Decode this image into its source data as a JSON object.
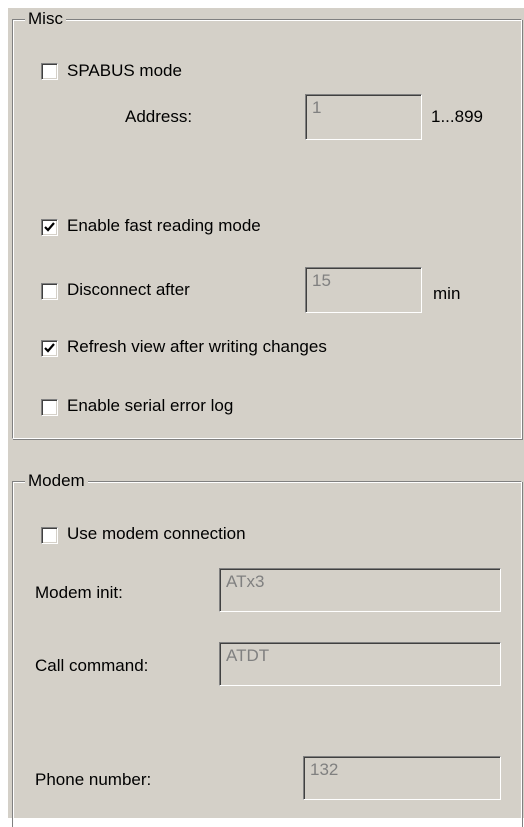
{
  "misc": {
    "title": "Misc",
    "spabus_mode": {
      "label": "SPABUS mode",
      "checked": false
    },
    "address": {
      "label": "Address:",
      "value": "1",
      "range": "1...899"
    },
    "fast_reading": {
      "label": "Enable fast reading mode",
      "checked": true
    },
    "disconnect": {
      "label": "Disconnect after",
      "checked": false,
      "value": "15",
      "unit": "min"
    },
    "refresh_view": {
      "label": "Refresh view after writing changes",
      "checked": true
    },
    "serial_error_log": {
      "label": "Enable serial error log",
      "checked": false
    }
  },
  "modem": {
    "title": "Modem",
    "use_modem": {
      "label": "Use modem connection",
      "checked": false
    },
    "modem_init": {
      "label": "Modem init:",
      "value": "ATx3"
    },
    "call_command": {
      "label": "Call command:",
      "value": "ATDT"
    },
    "phone_number": {
      "label": "Phone number:",
      "value": "132"
    }
  }
}
